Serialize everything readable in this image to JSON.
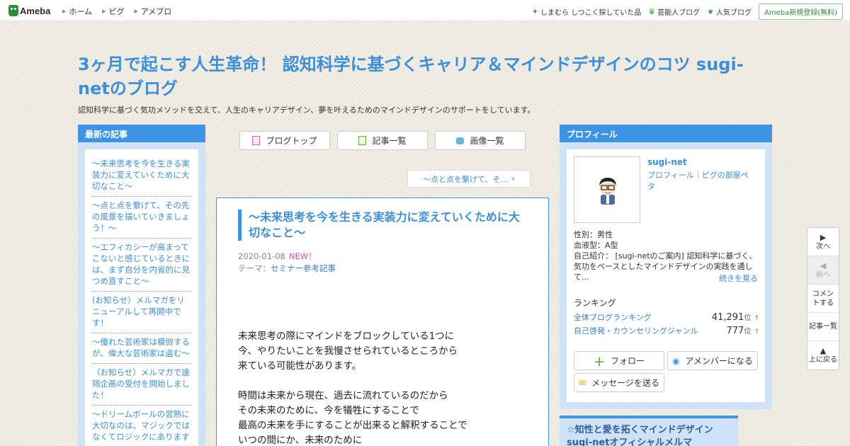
{
  "topbar": {
    "logo": "Ameba",
    "nav": [
      "ホーム",
      "ピグ",
      "アメブロ"
    ],
    "right": [
      {
        "icon": "sparkle-icon",
        "label": "しまむら しつこく探していた品"
      },
      {
        "icon": "crown-icon",
        "label": "芸能人ブログ"
      },
      {
        "icon": "star-icon",
        "label": "人気ブログ"
      }
    ],
    "register": "Ameba新規登録(無料)"
  },
  "header": {
    "title": "3ヶ月で起こす人生革命！ 認知科学に基づくキャリア＆マインドデザインのコツ sugi-netのブログ",
    "description": "認知科学に基づく気功メソッドを交えて、人生のキャリアデザイン、夢を叶えるためのマインドデザインのサポートをしています。"
  },
  "left": {
    "heading": "最新の記事",
    "posts": [
      "～未来思考を今を生きる実装力に変えていくために大切なこと～",
      "～点と点を繋げて、その先の風景を描いていきましょう！～",
      "～エフィカシーが高まってこないと感じているときには、まず自分を内省的に見つめ直すこと～",
      "(お知らせ）メルマガをリニューアルして再開中です！",
      "～優れた芸術家は模倣するが、偉大な芸術家は盗む～",
      "（お知らせ）メルマガで遠隔企画の受付を開始しました！",
      "～ドリームボールの習熟に大切なのは、マジックではなくてロジックにあります～"
    ]
  },
  "center": {
    "buttons": [
      "ブログトップ",
      "記事一覧",
      "画像一覧"
    ],
    "prev_post": "～点と点を繋げて、そ…",
    "article": {
      "title": "～未来思考を今を生きる実装力に変えていくために大切なこと～",
      "date": "2020-01-08",
      "new_label": "NEW！",
      "theme_label": "テーマ：",
      "theme": "セミナー参考記事",
      "body": [
        [
          "未来思考の際にマインドをブロックしている1つに",
          "今、やりたいことを我慢させられているところから",
          "来ている可能性があります。"
        ],
        [
          "時間は未来から現在、過去に流れているのだから",
          "その未来のために、今を犠牲にすることで",
          "最高の未来を手にすることが出来ると解釈することで",
          "いつの間にか、未来のために"
        ]
      ]
    }
  },
  "right": {
    "heading": "プロフィール",
    "name": "sugi-net",
    "links": "プロフィール｜ピグの部屋ペタ",
    "gender": "性別：男性",
    "blood": "血液型：A型",
    "intro": "自己紹介： [sugi-netのご案内] 認知科学に基づく、気功をベースとしたマインドデザインの実践を通して...",
    "more": "続きを見る",
    "ranking_head": "ランキング",
    "rankings": [
      {
        "label": "全体ブログランキング",
        "value": "41,291",
        "unit": "位",
        "trend": "↑"
      },
      {
        "label": "自己啓発・カウンセリングジャンル",
        "value": "777",
        "unit": "位",
        "trend": "↑"
      }
    ],
    "follow": "フォロー",
    "member": "アメンバーになる",
    "message": "メッセージを送る",
    "box2_title": "☆知性と愛を拓くマインドデザイン sugi-netオフィシャルメルマ"
  },
  "sidenav": {
    "next": "次へ",
    "prev": "前へ",
    "comment": "コメントする",
    "list": "記事一覧",
    "top": "上に戻る"
  },
  "colors": {
    "accent": "#3d94e6",
    "title": "#3c8fd8",
    "new": "#e94b9b",
    "brand": "#2d8c3c"
  }
}
